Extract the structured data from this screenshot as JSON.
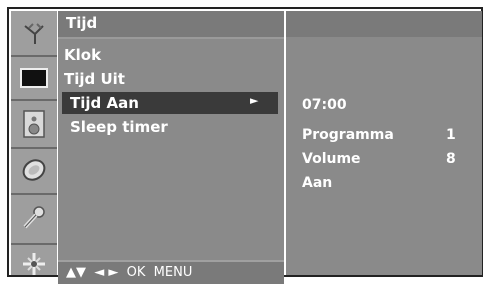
{
  "icons": {
    "items": [
      "antenna-icon",
      "picture-icon",
      "audio-icon",
      "time-icon",
      "option-icon",
      "settings-icon"
    ]
  },
  "menu": {
    "title": "Tijd",
    "items": [
      "Klok",
      "Tijd Uit",
      "Tijd Aan",
      "Sleep timer"
    ],
    "selected_index": 2,
    "arrow": "►",
    "nav_hint": "▲▼  ◄ ►  OK  MENU"
  },
  "info": {
    "time": "07:00",
    "programma_label": "Programma",
    "programma_value": "1",
    "volume_label": "Volume",
    "volume_value": "8",
    "state": "Aan"
  }
}
